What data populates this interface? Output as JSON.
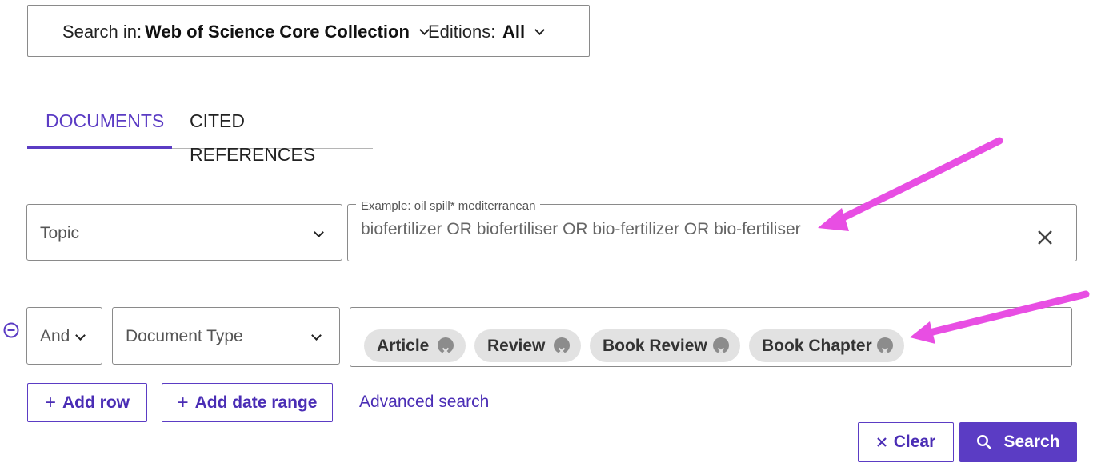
{
  "collection": {
    "search_in_label": "Search in:",
    "search_in_value": "Web of Science Core Collection",
    "editions_label": "Editions:",
    "editions_value": "All"
  },
  "tabs": [
    {
      "label": "DOCUMENTS",
      "active": true
    },
    {
      "label": "CITED REFERENCES",
      "active": false
    }
  ],
  "row1": {
    "field": "Topic",
    "query_placeholder_label": "Example: oil spill* mediterranean",
    "query_value": "biofertilizer OR biofertiliser OR bio-fertilizer OR bio-fertiliser"
  },
  "row2": {
    "operator": "And",
    "field": "Document Type",
    "chips": [
      "Article",
      "Review",
      "Book Review",
      "Book Chapter"
    ]
  },
  "actions": {
    "add_row": "Add row",
    "add_date_range": "Add date range",
    "advanced_search": "Advanced search",
    "clear": "Clear",
    "search": "Search"
  },
  "colors": {
    "accent": "#5b3cc4",
    "annotation_arrow": "#e84ee3"
  },
  "icons": [
    "chevron-down-icon",
    "close-icon",
    "remove-row-icon",
    "plus-icon",
    "search-icon",
    "chip-remove-icon"
  ]
}
